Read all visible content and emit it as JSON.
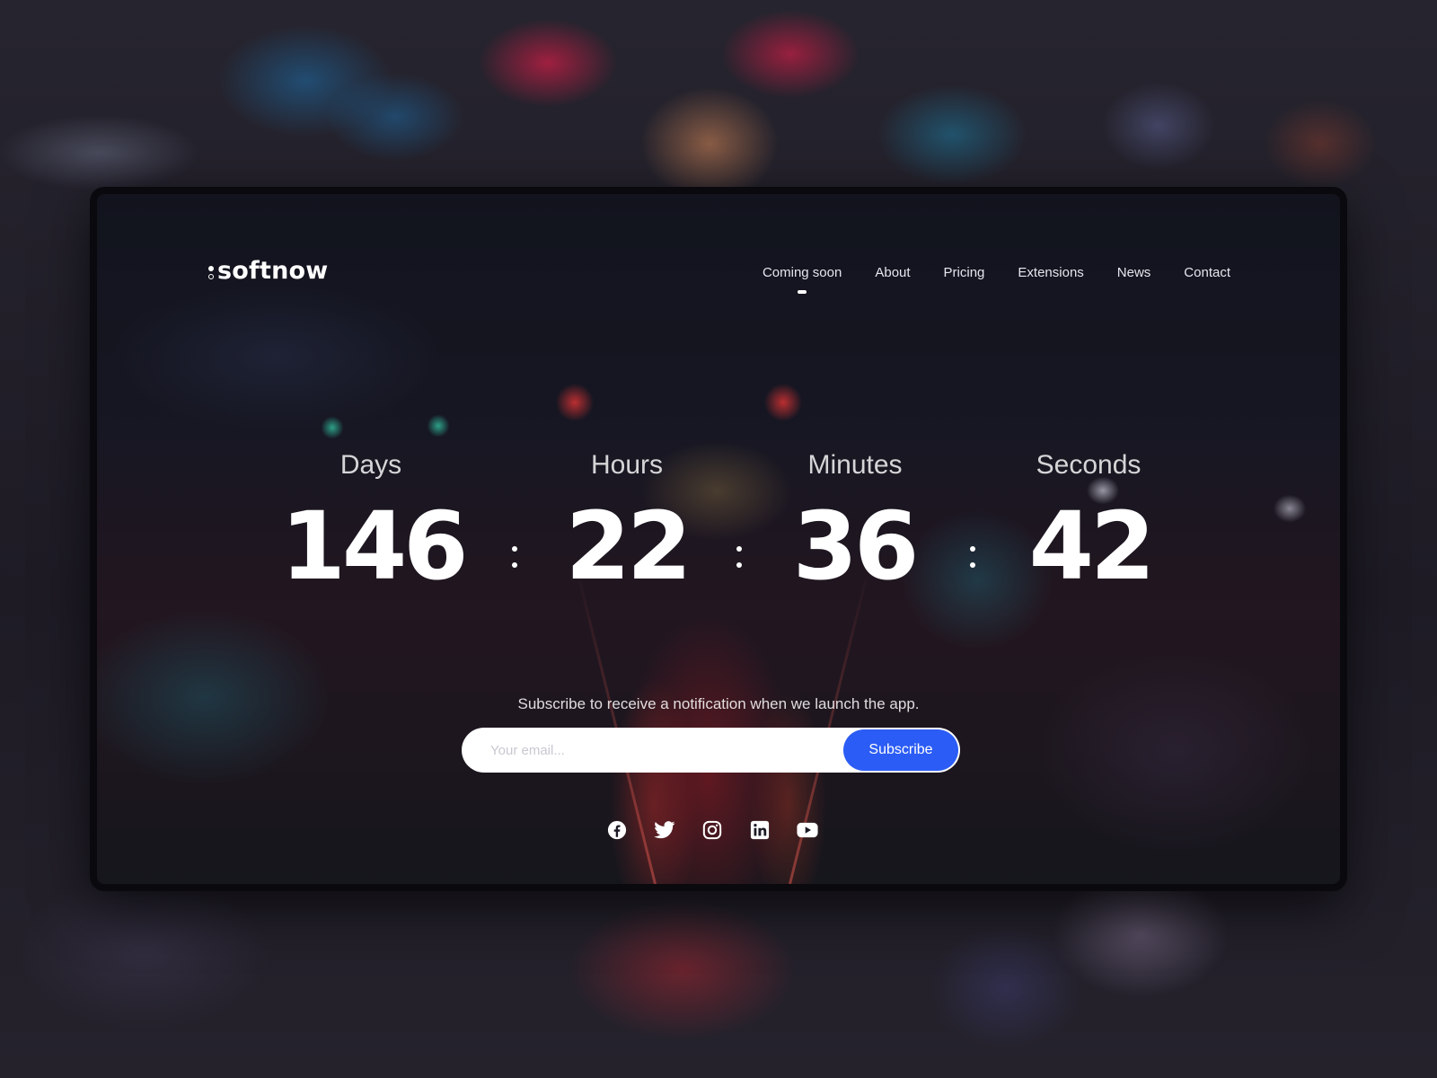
{
  "brand": {
    "name": "softnow"
  },
  "nav": {
    "items": [
      {
        "label": "Coming soon",
        "active": true
      },
      {
        "label": "About"
      },
      {
        "label": "Pricing"
      },
      {
        "label": "Extensions"
      },
      {
        "label": "News"
      },
      {
        "label": "Contact"
      }
    ]
  },
  "countdown": {
    "days": {
      "label": "Days",
      "value": "146"
    },
    "hours": {
      "label": "Hours",
      "value": "22"
    },
    "minutes": {
      "label": "Minutes",
      "value": "36"
    },
    "seconds": {
      "label": "Seconds",
      "value": "42"
    }
  },
  "subscribe": {
    "text": "Subscribe to receive a notification when we launch the app.",
    "placeholder": "Your email...",
    "button_label": "Subscribe"
  },
  "socials": [
    {
      "icon": "facebook-icon"
    },
    {
      "icon": "twitter-icon"
    },
    {
      "icon": "instagram-icon"
    },
    {
      "icon": "linkedin-icon"
    },
    {
      "icon": "youtube-icon"
    }
  ],
  "colors": {
    "accent": "#2b5cf5",
    "text": "#ffffff"
  }
}
